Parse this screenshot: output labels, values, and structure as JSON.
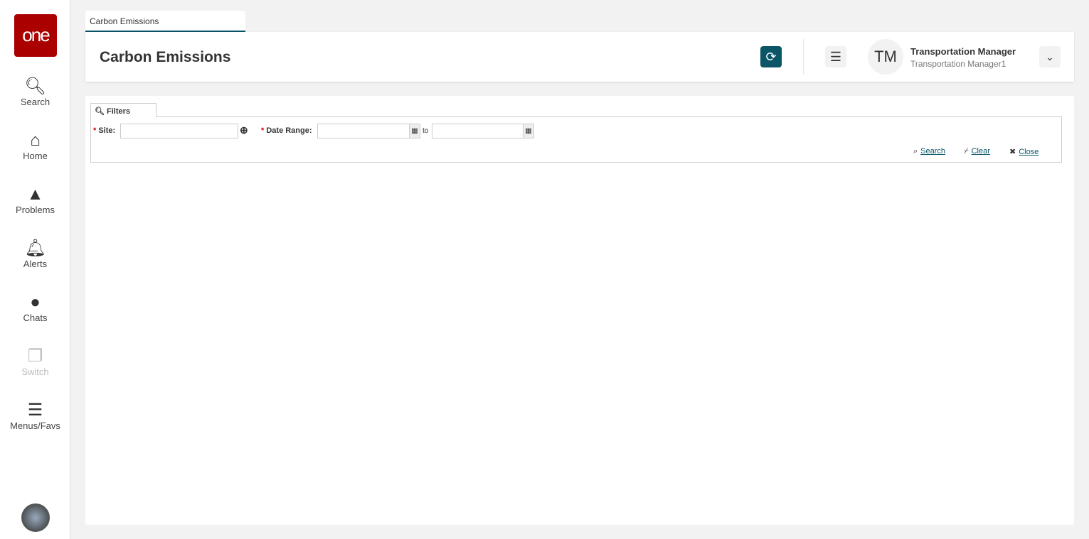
{
  "sidebar": {
    "logo": "one",
    "items": [
      {
        "label": "Search",
        "icon": "search-icon"
      },
      {
        "label": "Home",
        "icon": "home-icon"
      },
      {
        "label": "Problems",
        "icon": "warning-icon"
      },
      {
        "label": "Alerts",
        "icon": "bell-icon"
      },
      {
        "label": "Chats",
        "icon": "chat-icon"
      },
      {
        "label": "Switch",
        "icon": "switch-icon"
      },
      {
        "label": "Menus/Favs",
        "icon": "menu-icon"
      }
    ]
  },
  "tab": {
    "label": "Carbon Emissions"
  },
  "header": {
    "title": "Carbon Emissions",
    "user_initials": "TM",
    "user_name": "Transportation Manager",
    "user_role": "Transportation Manager1"
  },
  "filters": {
    "tab_label": "Filters",
    "site_label": "Site:",
    "date_range_label": "Date Range:",
    "to_label": "to",
    "site_value": "",
    "date_from": "",
    "date_to": "",
    "search": "Search",
    "clear": "Clear",
    "close": "Close"
  }
}
